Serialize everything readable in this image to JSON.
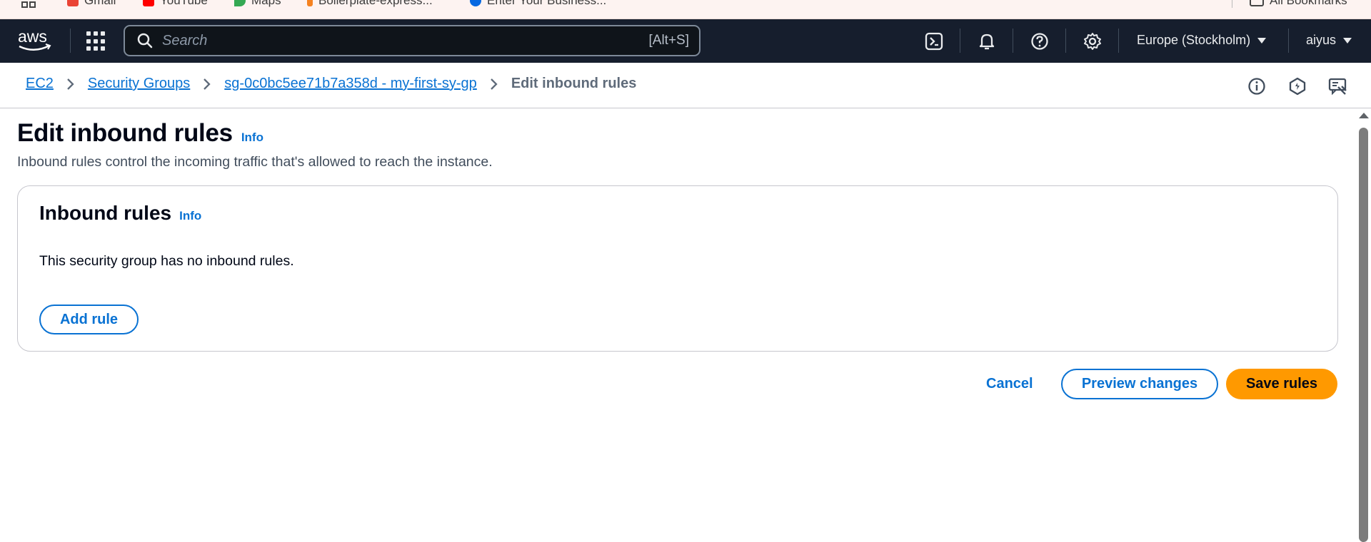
{
  "browser": {
    "bookmarks": [
      {
        "label": "Gmail",
        "icon": "gmail-icon",
        "color": "#ea4335"
      },
      {
        "label": "YouTube",
        "icon": "youtube-icon",
        "color": "#ff0000"
      },
      {
        "label": "Maps",
        "icon": "maps-icon",
        "color": "#34a853"
      },
      {
        "label": "Boilerplate-express...",
        "icon": "bookmark-icon",
        "color": "#f58220"
      },
      {
        "label": "Enter Your Business...",
        "icon": "meta-icon",
        "color": "#0668e1"
      }
    ],
    "all_bookmarks": "All Bookmarks"
  },
  "nav": {
    "logo": "aws",
    "search_placeholder": "Search",
    "search_hint": "[Alt+S]",
    "region": "Europe (Stockholm)",
    "user": "aiyus",
    "icons": [
      "cloudshell-icon",
      "bell-icon",
      "help-icon",
      "settings-icon"
    ]
  },
  "breadcrumb": {
    "items": [
      "EC2",
      "Security Groups",
      "sg-0c0bc5ee71b7a358d - my-first-sy-gp"
    ],
    "current": "Edit inbound rules"
  },
  "page": {
    "title": "Edit inbound rules",
    "info": "Info",
    "description": "Inbound rules control the incoming traffic that's allowed to reach the instance."
  },
  "panel": {
    "title": "Inbound rules",
    "info": "Info",
    "empty_message": "This security group has no inbound rules.",
    "add_rule": "Add rule"
  },
  "actions": {
    "cancel": "Cancel",
    "preview": "Preview changes",
    "save": "Save rules"
  },
  "colors": {
    "nav_bg": "#161e2d",
    "link": "#0972d3",
    "primary": "#ff9900"
  }
}
